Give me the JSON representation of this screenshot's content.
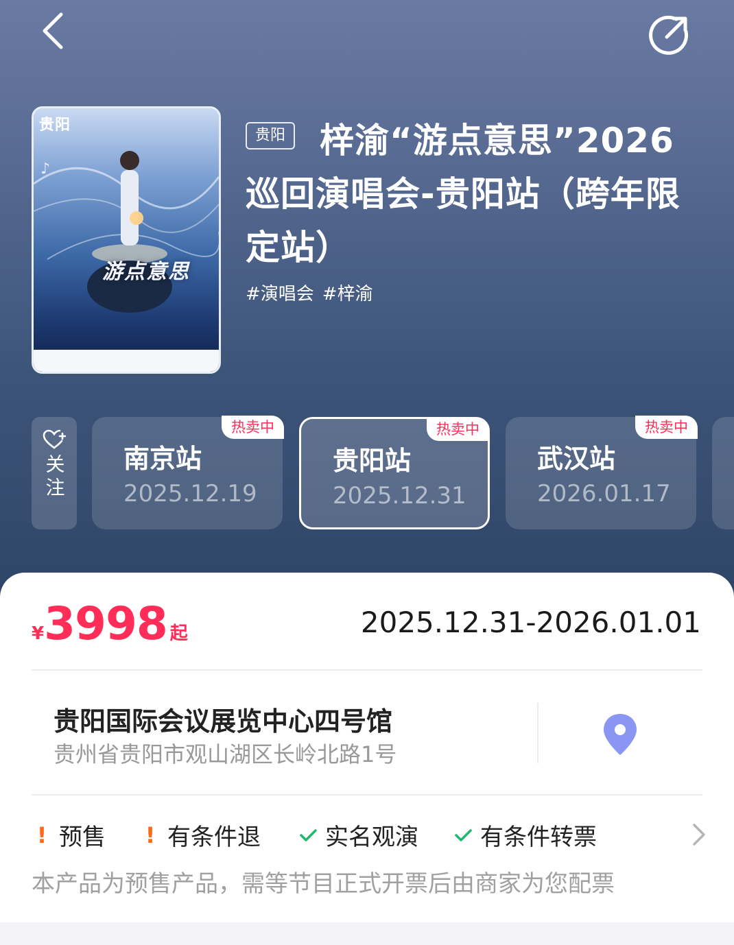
{
  "hero": {
    "city_tag": "贵阳",
    "title": "梓渝“游点意思”2026巡回演唱会-贵阳站（跨年限定站）",
    "hashtags": [
      "#演唱会",
      "#梓渝"
    ],
    "poster": {
      "brand": "贵阳",
      "art_title": "游点意思"
    }
  },
  "follow": {
    "label": "关注"
  },
  "stations": [
    {
      "name": "南京站",
      "date": "2025.12.19",
      "badge": "热卖中",
      "active": false
    },
    {
      "name": "贵阳站",
      "date": "2025.12.31",
      "badge": "热卖中",
      "active": true
    },
    {
      "name": "武汉站",
      "date": "2026.01.17",
      "badge": "热卖中",
      "active": false
    }
  ],
  "info": {
    "price_currency": "¥",
    "price_value": "3998",
    "price_suffix": "起",
    "date_range": "2025.12.31-2026.01.01",
    "venue_name": "贵阳国际会议展览中心四号馆",
    "venue_address": "贵州省贵阳市观山湖区长岭北路1号",
    "policies": [
      {
        "mark": "!",
        "type": "warning",
        "label": "预售"
      },
      {
        "mark": "!",
        "type": "warning",
        "label": "有条件退"
      },
      {
        "mark": "check",
        "type": "ok",
        "label": "实名观演"
      },
      {
        "mark": "check",
        "type": "ok",
        "label": "有条件转票"
      }
    ],
    "presale_note": "本产品为预售产品，需等节目正式开票后由商家为您配票"
  },
  "colors": {
    "accent_price": "#ff2d57",
    "warning": "#ff6a1a",
    "ok": "#1fb86f",
    "map_pin": "#8b95f2"
  },
  "icons": [
    "back-arrow-icon",
    "share-icon",
    "heart-plus-icon",
    "map-pin-icon",
    "check-icon",
    "chevron-right-icon"
  ]
}
